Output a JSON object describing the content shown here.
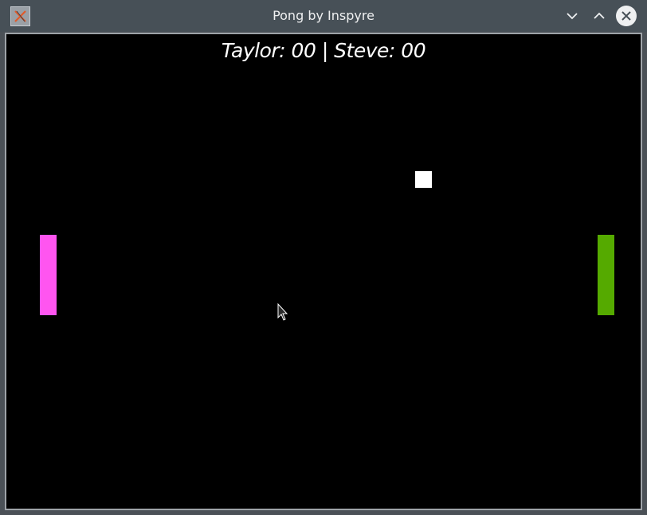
{
  "window": {
    "title": "Pong by Inspyre"
  },
  "game": {
    "score_text": "Taylor: 00 | Steve: 00",
    "players": [
      {
        "name": "Taylor",
        "score": "00",
        "paddle_color": "#ff55f0"
      },
      {
        "name": "Steve",
        "score": "00",
        "paddle_color": "#55aa00"
      }
    ],
    "ball_color": "#ffffff",
    "background_color": "#000000"
  },
  "icons": {
    "app": "x-app-icon",
    "minimize": "chevron-down-icon",
    "maximize": "chevron-up-icon",
    "close": "close-icon",
    "cursor": "mouse-pointer-icon"
  }
}
